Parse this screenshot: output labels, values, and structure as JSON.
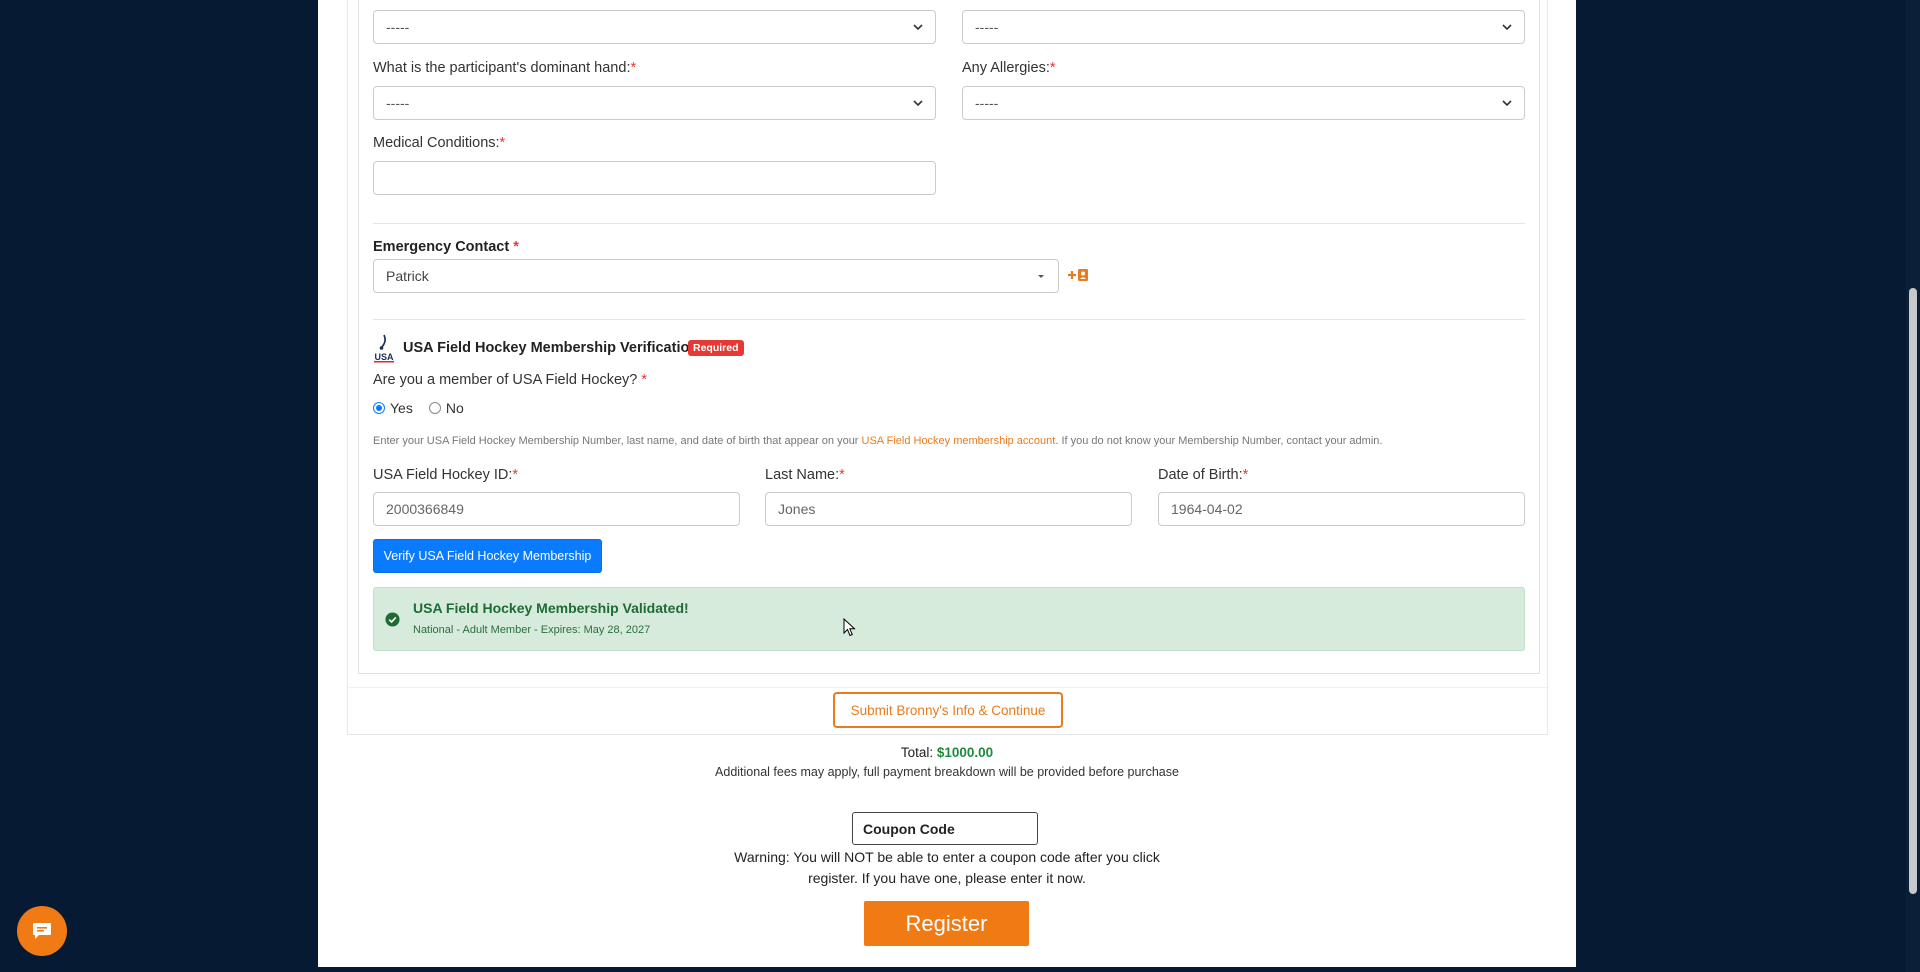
{
  "form": {
    "row1_left_value": "-----",
    "row1_right_value": "-----",
    "dominant_hand_label": "What is the participant's dominant hand:",
    "dominant_hand_value": "-----",
    "allergies_label": "Any Allergies:",
    "allergies_value": "-----",
    "medical_label": "Medical Conditions:",
    "medical_value": "",
    "required_mark": "*"
  },
  "emergency": {
    "label": "Emergency Contact",
    "value": "Patrick"
  },
  "usafh": {
    "title": "USA Field Hockey Membership Verification",
    "badge": "Required",
    "logo_text": "USA",
    "question": "Are you a member of USA Field Hockey?",
    "yes_label": "Yes",
    "no_label": "No",
    "selected": "yes",
    "help_before": "Enter your USA Field Hockey Membership Number, last name, and date of birth that appear on your ",
    "help_link": "USA Field Hockey membership account",
    "help_after": ". If you do not know your Membership Number, contact your admin.",
    "id_label": "USA Field Hockey ID:",
    "id_value": "2000366849",
    "last_name_label": "Last Name:",
    "last_name_value": "Jones",
    "dob_label": "Date of Birth:",
    "dob_value": "1964-04-02",
    "verify_button": "Verify USA Field Hockey Membership",
    "validated_title": "USA Field Hockey Membership Validated!",
    "validated_detail": "National - Adult Member - Expires: May 28, 2027"
  },
  "submit_button": "Submit Bronny's Info & Continue",
  "total": {
    "label": "Total:",
    "amount": "$1000.00",
    "note": "Additional fees may apply, full payment breakdown will be provided before purchase"
  },
  "coupon": {
    "placeholder": "Coupon Code",
    "warning_line1": "Warning: You will NOT be able to enter a coupon code after you click",
    "warning_line2": "register. If you have one, please enter it now."
  },
  "register_button": "Register",
  "colors": {
    "accent": "#f07a14",
    "primary": "#0a7bff",
    "success_bg": "#d6ebdb",
    "success_text": "#1e6b34",
    "background": "#061a33"
  }
}
